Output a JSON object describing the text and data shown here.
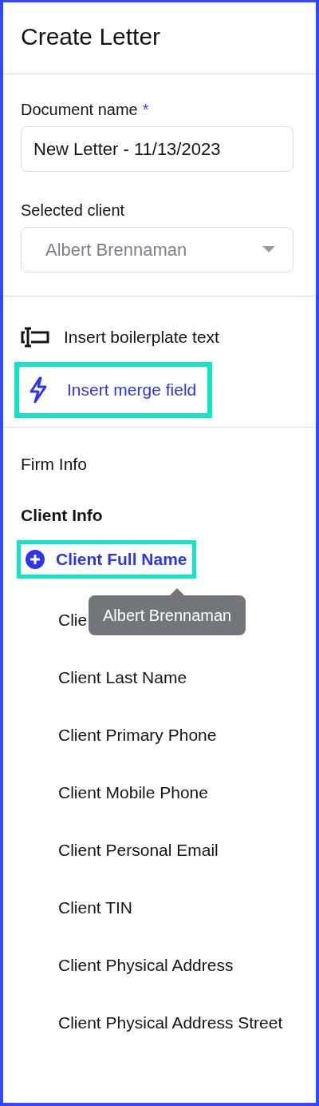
{
  "title": "Create Letter",
  "form": {
    "document_name": {
      "label": "Document name",
      "required_mark": "*",
      "value": "New Letter - 11/13/2023"
    },
    "selected_client": {
      "label": "Selected client",
      "value": "Albert Brennaman",
      "disabled": true
    }
  },
  "actions": [
    {
      "kind": "boilerplate",
      "label": "Insert boilerplate text",
      "selected": false,
      "highlighted": false
    },
    {
      "kind": "merge",
      "label": "Insert merge field",
      "selected": true,
      "highlighted": true
    }
  ],
  "groups": [
    {
      "label": "Firm Info",
      "expanded": false
    },
    {
      "label": "Client Info",
      "expanded": true,
      "items": [
        {
          "label": "Client Full Name",
          "selected": true,
          "highlighted": true,
          "tooltip": "Albert Brennaman"
        },
        {
          "label": "Clie",
          "selected": false,
          "highlighted": false
        },
        {
          "label": "Client Last Name",
          "selected": false,
          "highlighted": false
        },
        {
          "label": "Client Primary Phone",
          "selected": false,
          "highlighted": false
        },
        {
          "label": "Client Mobile Phone",
          "selected": false,
          "highlighted": false
        },
        {
          "label": "Client Personal Email",
          "selected": false,
          "highlighted": false
        },
        {
          "label": "Client TIN",
          "selected": false,
          "highlighted": false
        },
        {
          "label": "Client Physical Address",
          "selected": false,
          "highlighted": false
        },
        {
          "label": "Client Physical Address Street",
          "selected": false,
          "highlighted": false
        }
      ]
    }
  ]
}
